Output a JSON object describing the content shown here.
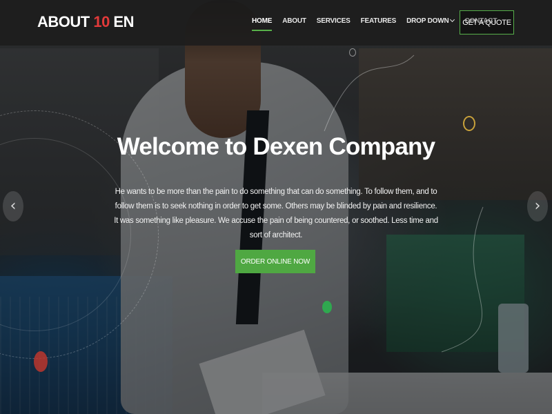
{
  "brand": {
    "prefix": "ABOUT ",
    "accent": "10",
    "suffix": " EN"
  },
  "nav": {
    "items": [
      {
        "label": "HOME",
        "active": true
      },
      {
        "label": "ABOUT",
        "active": false
      },
      {
        "label": "SERVICES",
        "active": false
      },
      {
        "label": "FEATURES",
        "active": false
      },
      {
        "label": "DROP DOWN",
        "active": false,
        "dropdown": true
      },
      {
        "label": "CONTACT",
        "active": false
      }
    ],
    "cta_label": "GET A QUOTE"
  },
  "hero": {
    "title": "Welcome to Dexen Company",
    "description": "He wants to be more than the pain to do something that can do something. To follow them, and to follow them is to seek nothing in order to get some. Others may be blinded by pain and resilience. It was something like pleasure. We accuse the pain of being countered, or soothed. Less time and sort of architect.",
    "button_label": "ORDER ONLINE NOW",
    "prev_icon": "chevron-left-icon",
    "next_icon": "chevron-right-icon"
  },
  "colors": {
    "accent_green": "#4fa842",
    "brand_red": "#e23a3a",
    "header_bg": "#1c1c1c"
  }
}
